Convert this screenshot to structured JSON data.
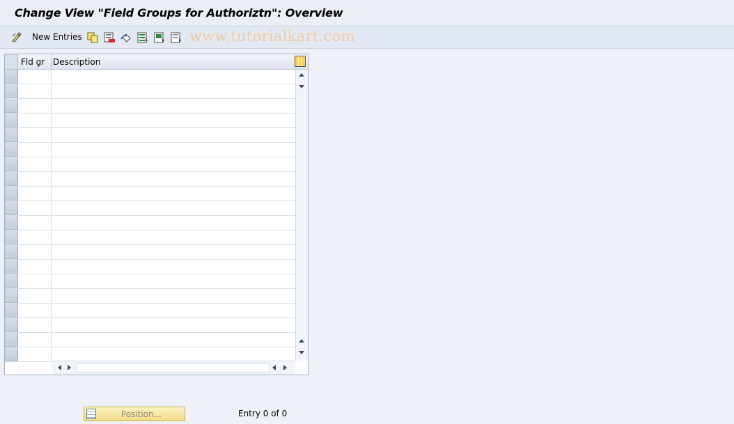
{
  "window": {
    "title": "Change View \"Field Groups for Authoriztn\": Overview"
  },
  "toolbar": {
    "new_entries_label": "New Entries",
    "watermark": "www.tutorialkart.com",
    "icons": [
      "display-change-icon",
      "copy-icon",
      "delete-icon",
      "undo-icon",
      "select-all-icon",
      "select-block-icon",
      "deselect-all-icon"
    ]
  },
  "table": {
    "columns": [
      "Fld gr",
      "Description"
    ],
    "rows": [
      {
        "fld_gr": "",
        "description": ""
      },
      {
        "fld_gr": "",
        "description": ""
      },
      {
        "fld_gr": "",
        "description": ""
      },
      {
        "fld_gr": "",
        "description": ""
      },
      {
        "fld_gr": "",
        "description": ""
      },
      {
        "fld_gr": "",
        "description": ""
      },
      {
        "fld_gr": "",
        "description": ""
      },
      {
        "fld_gr": "",
        "description": ""
      },
      {
        "fld_gr": "",
        "description": ""
      },
      {
        "fld_gr": "",
        "description": ""
      },
      {
        "fld_gr": "",
        "description": ""
      },
      {
        "fld_gr": "",
        "description": ""
      },
      {
        "fld_gr": "",
        "description": ""
      },
      {
        "fld_gr": "",
        "description": ""
      },
      {
        "fld_gr": "",
        "description": ""
      },
      {
        "fld_gr": "",
        "description": ""
      },
      {
        "fld_gr": "",
        "description": ""
      },
      {
        "fld_gr": "",
        "description": ""
      },
      {
        "fld_gr": "",
        "description": ""
      },
      {
        "fld_gr": "",
        "description": ""
      }
    ]
  },
  "footer": {
    "position_label": "Position...",
    "entry_text": "Entry 0 of 0"
  },
  "colors": {
    "background": "#eef2f8",
    "position_button": "#f2dc86",
    "watermark": "#f2c9a0"
  }
}
